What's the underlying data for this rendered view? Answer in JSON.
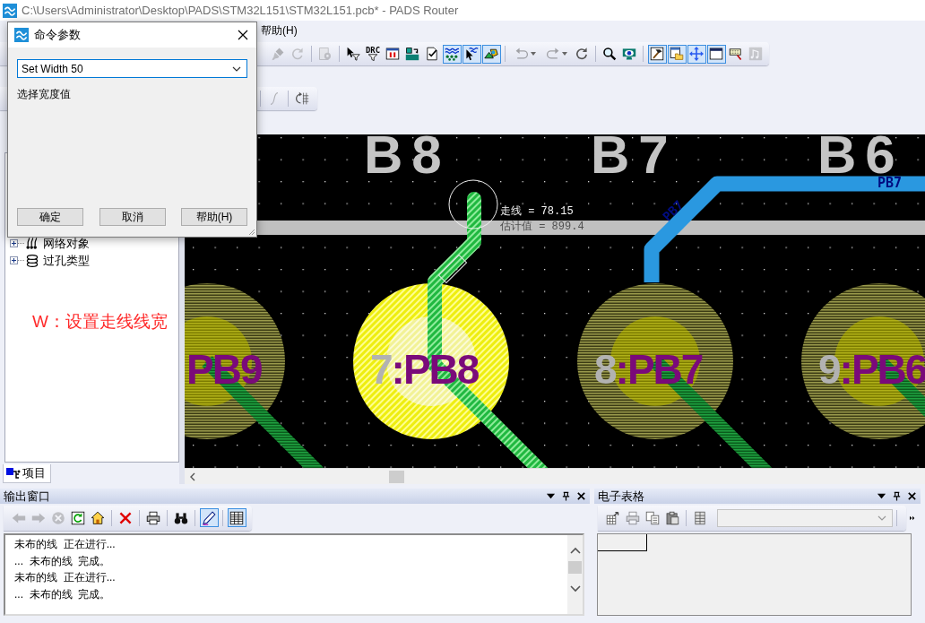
{
  "window": {
    "title": "C:\\Users\\Administrator\\Desktop\\PADS\\STM32L151\\STM32L151.pcb* - PADS Router",
    "menu": [
      "帮助(H)"
    ]
  },
  "toolbars": [
    [
      [
        {
          "kind": "brush",
          "on": false,
          "disabled": true
        },
        {
          "kind": "refresh",
          "on": false,
          "disabled": true
        }
      ],
      [
        {
          "kind": "gear-doc",
          "on": false,
          "disabled": true
        }
      ],
      [
        {
          "kind": "pointer-filter",
          "on": false,
          "disabled": false
        },
        {
          "kind": "drc-filter",
          "label": "DRC",
          "on": false,
          "disabled": false
        },
        {
          "kind": "window-pause",
          "on": false,
          "disabled": false
        },
        {
          "kind": "swap",
          "on": false,
          "disabled": false
        },
        {
          "kind": "check-doc",
          "on": false,
          "disabled": false
        },
        {
          "kind": "net-dots",
          "on": true,
          "disabled": false
        },
        {
          "kind": "pointer-net",
          "on": true,
          "disabled": false
        },
        {
          "kind": "shapes",
          "on": true,
          "disabled": false
        }
      ],
      [
        {
          "kind": "undo",
          "on": false,
          "disabled": true
        },
        {
          "kind": "redo",
          "on": false,
          "disabled": true
        },
        {
          "kind": "rotate",
          "on": false,
          "disabled": false
        }
      ],
      [
        {
          "kind": "magnifier",
          "on": false,
          "disabled": false
        },
        {
          "kind": "eye-monitor",
          "on": false,
          "disabled": false
        }
      ],
      [
        {
          "kind": "hammer-picture",
          "on": true,
          "disabled": false
        },
        {
          "kind": "folder-window",
          "on": true,
          "disabled": false
        },
        {
          "kind": "move-arrows",
          "on": true,
          "disabled": false
        },
        {
          "kind": "window",
          "on": true,
          "disabled": false
        },
        {
          "kind": "keyboard",
          "on": false,
          "disabled": false
        },
        {
          "kind": "note-tile",
          "on": false,
          "disabled": true
        }
      ]
    ],
    [
      [
        {
          "kind": "curve",
          "on": false,
          "disabled": true
        }
      ],
      [
        {
          "kind": "grid-rotate",
          "on": false,
          "disabled": false
        }
      ]
    ]
  ],
  "dialog": {
    "title": "命令参数",
    "command": "Set Width 50",
    "prompt": "选择宽度值",
    "buttons": [
      "确定",
      "取消",
      "帮助(H)"
    ]
  },
  "project_tree": {
    "items": [
      {
        "kind": "nets",
        "label": "网络对象",
        "expanded": false
      },
      {
        "kind": "vias",
        "label": "过孔类型",
        "expanded": false
      }
    ],
    "tab": "项目"
  },
  "annotation": "W：设置走线线宽",
  "board": {
    "silkscreen": [
      "B8",
      "B7",
      "B6"
    ],
    "net_labels": [
      {
        "kind": "horizontal",
        "text": "PB7"
      },
      {
        "kind": "diagonal",
        "text": "PB7"
      }
    ],
    "readouts": [
      "走线 = 78.15",
      "估计值 = 899.4"
    ],
    "pads": [
      {
        "label": "PB9",
        "selected": false
      },
      {
        "number": "7",
        "label": ":PB8",
        "selected": true
      },
      {
        "number": "8",
        "label": ":PB7",
        "selected": false
      },
      {
        "number": "9",
        "label": ":PB6",
        "selected": false
      }
    ]
  },
  "output": {
    "title": "输出窗口",
    "tools": [
      [
        {
          "kind": "back",
          "on": false,
          "disabled": true
        },
        {
          "kind": "forward",
          "on": false,
          "disabled": true
        },
        {
          "kind": "stop",
          "on": false,
          "disabled": true
        },
        {
          "kind": "refresh-box",
          "on": false,
          "disabled": false
        },
        {
          "kind": "home",
          "on": false,
          "disabled": false
        }
      ],
      [
        {
          "kind": "delete",
          "on": false,
          "disabled": false
        }
      ],
      [
        {
          "kind": "printer",
          "on": false,
          "disabled": false
        }
      ],
      [
        {
          "kind": "binoculars",
          "on": false,
          "disabled": false
        }
      ],
      [
        {
          "kind": "pen",
          "on": true,
          "disabled": false
        }
      ],
      [
        {
          "kind": "table",
          "on": true,
          "disabled": false
        }
      ]
    ],
    "lines": [
      "未布的线  正在进行...",
      "...  未布的线  完成。",
      "未布的线  正在进行...",
      "...  未布的线  完成。"
    ]
  },
  "spreadsheet": {
    "title": "电子表格",
    "tools": [
      [
        {
          "kind": "table-export",
          "on": false,
          "disabled": false
        },
        {
          "kind": "printer",
          "on": false,
          "disabled": true
        },
        {
          "kind": "copy",
          "on": false,
          "disabled": false
        },
        {
          "kind": "paste",
          "on": false,
          "disabled": false
        }
      ],
      [
        {
          "kind": "table-doc",
          "on": false,
          "disabled": false
        }
      ]
    ],
    "selector": {
      "disabled": true
    }
  }
}
